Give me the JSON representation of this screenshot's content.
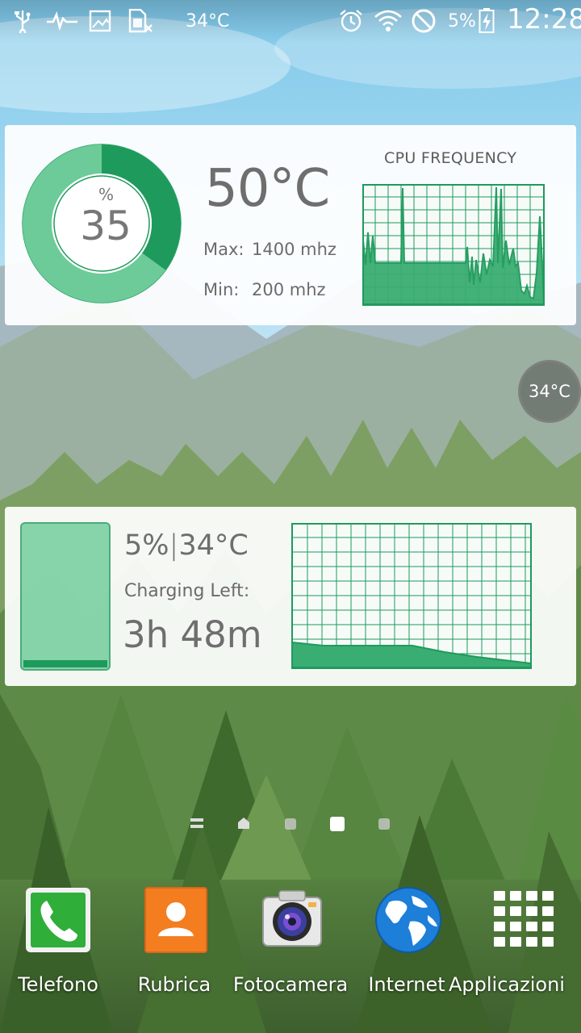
{
  "status_bar": {
    "icons": [
      "usb-icon",
      "pulse-icon",
      "picture-icon",
      "sim-off-icon",
      "alarm-icon",
      "wifi-icon",
      "do-not-disturb-icon",
      "battery-charging-icon"
    ],
    "temperature": "34°C",
    "battery_percent": "5%",
    "time": "12:28"
  },
  "cpu_widget": {
    "usage_unit": "%",
    "usage_value": "35",
    "usage_level": 0.35,
    "temperature": "50°C",
    "max_label": "Max:",
    "max_value": "1400 mhz",
    "min_label": "Min:",
    "min_value": "200 mhz",
    "graph_title": "CPU FREQUENCY"
  },
  "floating_temp": "34°C",
  "battery_widget": {
    "percent": "5%",
    "separator": "|",
    "temperature": "34°C",
    "charging_label": "Charging Left:",
    "charging_time": "3h 48m",
    "level": 0.05
  },
  "dock": {
    "items": [
      {
        "label": "Telefono",
        "icon": "phone-icon"
      },
      {
        "label": "Rubrica",
        "icon": "contacts-icon"
      },
      {
        "label": "Fotocamera",
        "icon": "camera-icon"
      },
      {
        "label": "Internet",
        "icon": "globe-icon"
      },
      {
        "label": "Applicazioni",
        "icon": "apps-grid-icon"
      }
    ]
  },
  "colors": {
    "accent_green": "#1e9a5c",
    "graph_fill": "#3aae72"
  }
}
